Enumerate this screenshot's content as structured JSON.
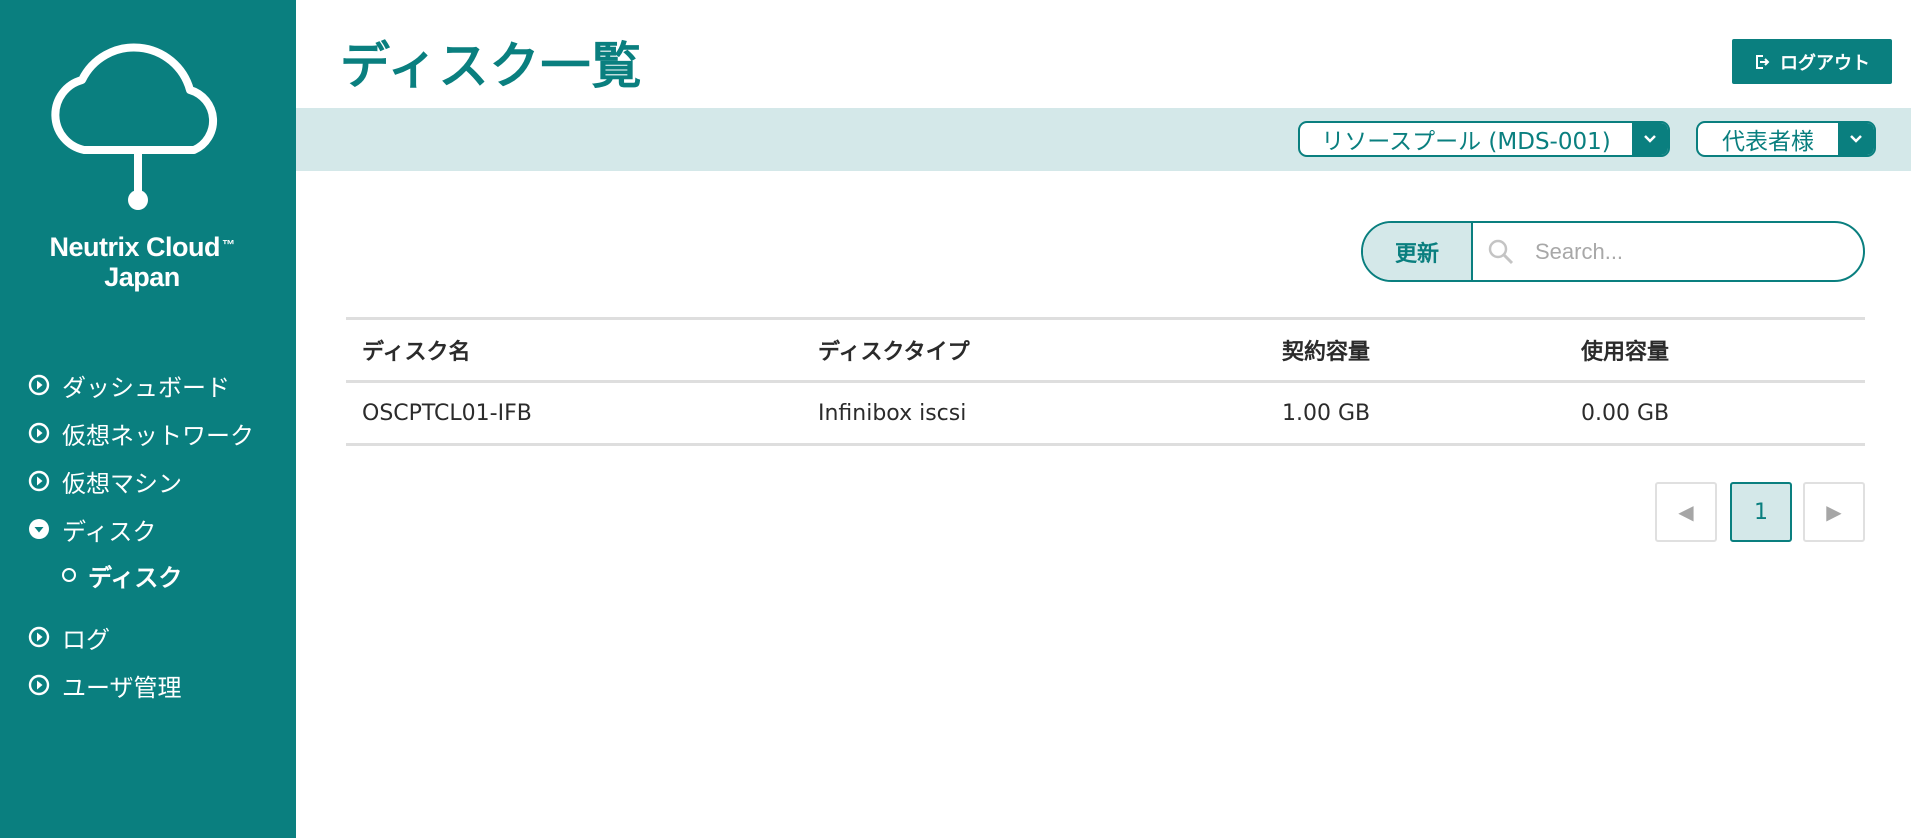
{
  "brand": {
    "line1": "Neutrix Cloud",
    "tm": "™",
    "line2": "Japan"
  },
  "sidebar": {
    "items": [
      {
        "label": "ダッシュボード",
        "icon": "play-circle-icon"
      },
      {
        "label": "仮想ネットワーク",
        "icon": "play-circle-icon"
      },
      {
        "label": "仮想マシン",
        "icon": "play-circle-icon"
      },
      {
        "label": "ディスク",
        "icon": "chevron-down-circle-icon",
        "expanded": true,
        "children": [
          {
            "label": "ディスク",
            "active": true
          }
        ]
      },
      {
        "label": "ログ",
        "icon": "play-circle-icon"
      },
      {
        "label": "ユーザ管理",
        "icon": "play-circle-icon"
      }
    ]
  },
  "header": {
    "title": "ディスク一覧",
    "logout_label": "ログアウト"
  },
  "filters": {
    "resource_pool": "リソースプール (MDS-001)",
    "user": "代表者様"
  },
  "toolbar": {
    "refresh_label": "更新",
    "search_placeholder": "Search..."
  },
  "table": {
    "columns": [
      "ディスク名",
      "ディスクタイプ",
      "契約容量",
      "使用容量"
    ],
    "rows": [
      [
        "OSCPTCL01-IFB",
        "Infinibox iscsi",
        "1.00 GB",
        "0.00 GB"
      ]
    ]
  },
  "pagination": {
    "current_page": "1"
  },
  "colors": {
    "accent": "#0a7f7f",
    "accent_light": "#d4e8e9",
    "border": "#dedede"
  }
}
